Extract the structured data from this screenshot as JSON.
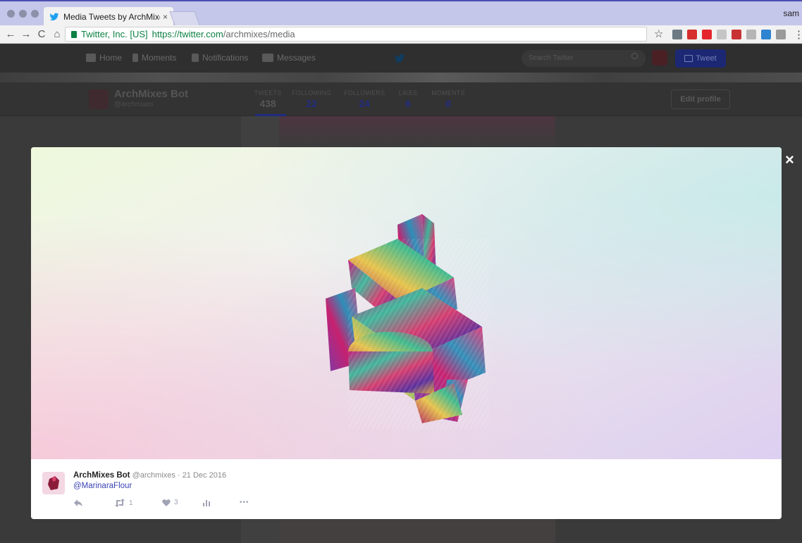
{
  "browser": {
    "tab_title": "Media Tweets by ArchMixes Bo",
    "tab_close": "×",
    "profile_label": "sam",
    "back": "←",
    "forward": "→",
    "reload": "C",
    "home": "⌂",
    "secure_label": "Twitter, Inc. [US]",
    "url_base": "https://twitter.com",
    "url_path": "/archmixes/media",
    "star": "☆",
    "menu": "⋮",
    "extension_colors": [
      "#6d7a84",
      "#d62d2d",
      "#e4262c",
      "#c5c5c5",
      "#c83232",
      "#b5b5b5",
      "#2e84d0",
      "#9a9a9a"
    ]
  },
  "twitter": {
    "nav": {
      "home": "Home",
      "moments": "Moments",
      "notifications": "Notifications",
      "messages": "Messages",
      "search_placeholder": "Search Twitter",
      "tweet_button": "Tweet"
    },
    "profile": {
      "name": "ArchMixes Bot",
      "handle": "@archmixes",
      "edit_button": "Edit profile",
      "stats": [
        {
          "label": "TWEETS",
          "value": "438"
        },
        {
          "label": "FOLLOWING",
          "value": "22"
        },
        {
          "label": "FOLLOWERS",
          "value": "24"
        },
        {
          "label": "LIKES",
          "value": "6"
        },
        {
          "label": "MOMENTS",
          "value": "0"
        }
      ]
    }
  },
  "modal": {
    "close_label": "×",
    "tweet": {
      "author_name": "ArchMixes Bot",
      "author_handle": "@archmixes",
      "separator": "·",
      "date": "21 Dec 2016",
      "mention": "@MarinaraFlour",
      "retweet_count": "1",
      "like_count": "3",
      "more": "•••"
    }
  },
  "colors": {
    "twitter_accent": "#3a43b3",
    "modal_bg": "#ffffff",
    "tab_strip": "#c4c6ea"
  }
}
